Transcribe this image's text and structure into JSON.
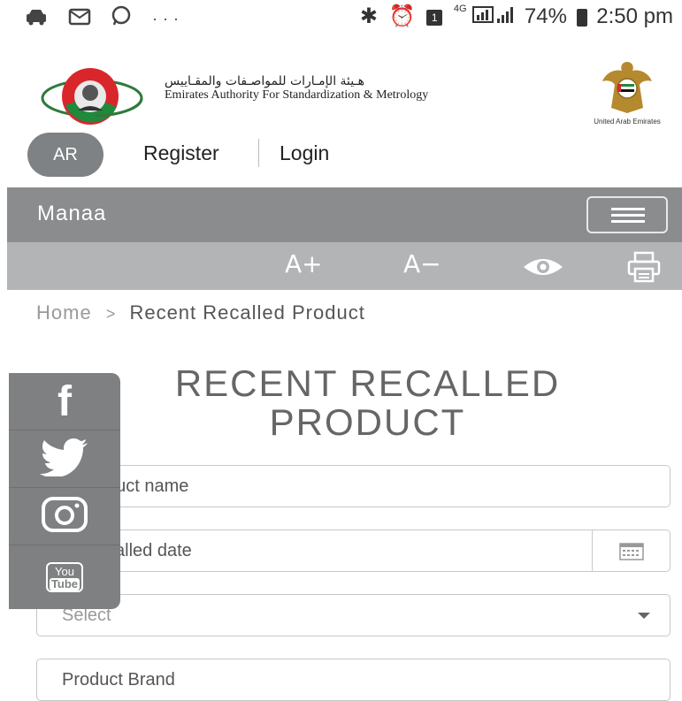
{
  "status_bar": {
    "left_icons": [
      "car-icon",
      "message-icon",
      "whatsapp-icon"
    ],
    "more": "···",
    "network": "4G",
    "battery": "74%",
    "time": "2:50 pm"
  },
  "header": {
    "logo_arabic": "هـيئة الإمـارات للمواصـفات والمقـاييس",
    "logo_english": "Emirates Authority For Standardization & Metrology",
    "crest_caption": "United Arab Emirates"
  },
  "auth": {
    "language": "AR",
    "register": "Register",
    "login": "Login"
  },
  "nav": {
    "title": "Manaa"
  },
  "accessibility": {
    "font_increase": "A+",
    "font_decrease": "A−"
  },
  "breadcrumb": {
    "home": "Home",
    "separator": ">",
    "current": "Recent Recalled Product"
  },
  "page": {
    "title_line1": "RECENT RECALLED",
    "title_line2": "PRODUCT"
  },
  "form": {
    "name_placeholder": "in product name",
    "date_placeholder": "uct recalled date",
    "select_value": "Select",
    "brand_placeholder": "Product Brand"
  },
  "social": {
    "facebook": "f",
    "youtube_top": "You",
    "youtube_bottom": "Tube"
  },
  "colors": {
    "nav_bar": "#8a8c8e",
    "access_bar": "#b3b4b6",
    "social_panel": "#7e8082",
    "lang_button": "#7f8284"
  }
}
